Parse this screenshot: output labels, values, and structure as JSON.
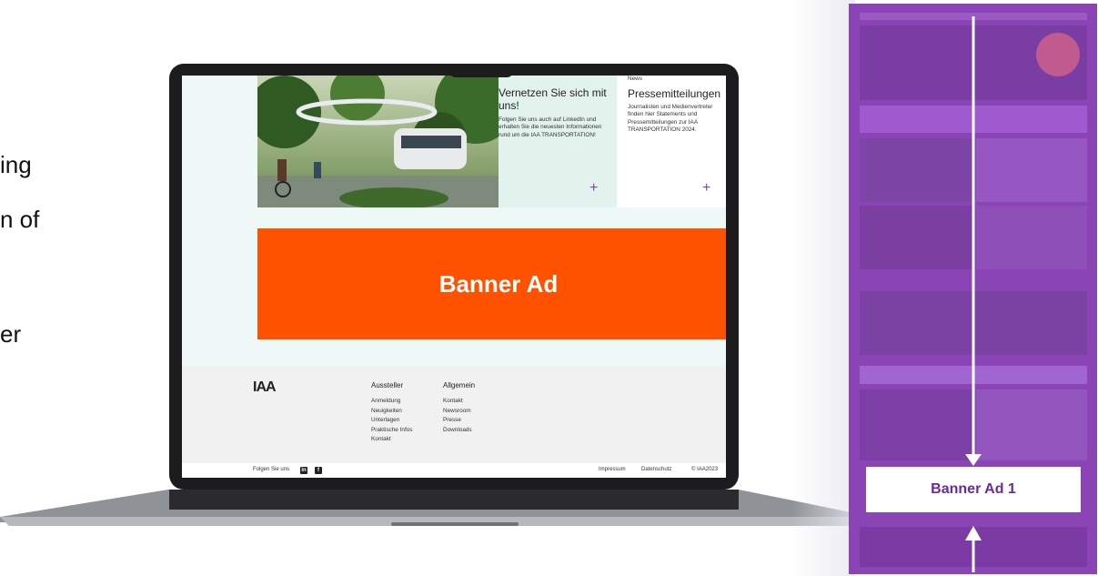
{
  "left_text": {
    "line1": "ing",
    "line2": "n of",
    "line3": "er"
  },
  "screen": {
    "card1": {
      "title": "Vernetzen Sie sich mit uns!",
      "body": "Folgen Sie uns auch auf LinkedIn und erhalten Sie die neuesten Informationen rund um die IAA TRANSPORTATION!",
      "plus": "+"
    },
    "card2": {
      "kicker": "News",
      "title": "Pressemitteilungen",
      "body": "Journalisten und Medienvertreter finden hier Statements und Pressemitteilungen zur IAA TRANSPORTATION 2024.",
      "plus": "+"
    },
    "banner_label": "Banner Ad",
    "footer": {
      "logo": "IAA",
      "col1_heading": "Aussteller",
      "col1_items": [
        "Anmeldung",
        "Neuigkeiten",
        "Unterlagen",
        "Praktische Infos",
        "Kontakt"
      ],
      "col2_heading": "Allgemein",
      "col2_items": [
        "Kontakt",
        "Newsroom",
        "Presse",
        "Downloads"
      ]
    },
    "bottom_bar": {
      "follow": "Folgen Sie uns",
      "linkedin": "in",
      "facebook": "f",
      "impressum": "Impressum",
      "datenschutz": "Datenschutz",
      "copyright": "© IAA2023"
    }
  },
  "right_panel": {
    "banner_label": "Banner Ad 1",
    "panel_color": "#8b44b5"
  },
  "colors": {
    "banner": "#ff5200",
    "accent_plus": "#7a4aa8"
  }
}
